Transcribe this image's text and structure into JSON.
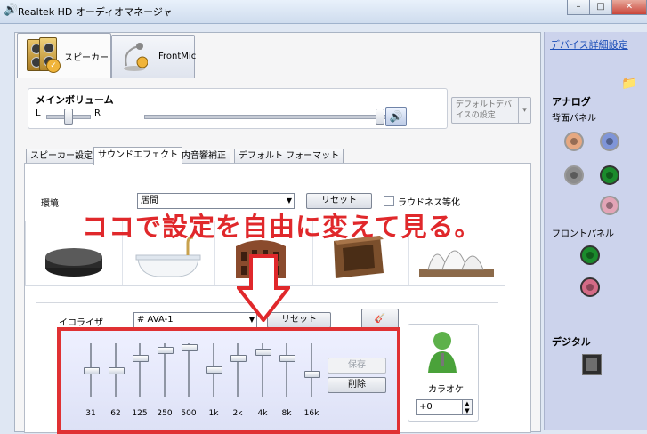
{
  "window": {
    "title": "Realtek HD オーディオマネージャ"
  },
  "device_tabs": [
    {
      "label": "スピーカー"
    },
    {
      "label": "FrontMic"
    }
  ],
  "main_volume": {
    "title": "メインボリューム",
    "left": "L",
    "right": "R"
  },
  "default_device": {
    "label": "デフォルトデバイスの設定"
  },
  "sub_tabs": [
    {
      "label": "スピーカー設定"
    },
    {
      "label": "サウンドエフェクト"
    },
    {
      "label": "室内音響補正"
    },
    {
      "label": "デフォルト フォーマット"
    }
  ],
  "environment": {
    "label": "環境",
    "selected": "居間",
    "reset_label": "リセット",
    "loudness_label": "ラウドネス等化",
    "presets": [
      "stone-disc-icon",
      "bathtub-icon",
      "colosseum-icon",
      "stone-room-icon",
      "opera-house-icon"
    ]
  },
  "annotation": {
    "text": "ココで設定を自由に変えて見る。"
  },
  "equalizer": {
    "label": "イコライザ",
    "selected": "# AVA-1",
    "reset_label": "リセット",
    "save_label": "保存",
    "delete_label": "削除",
    "bands": [
      {
        "freq": "31",
        "level": 0.48
      },
      {
        "freq": "62",
        "level": 0.48
      },
      {
        "freq": "125",
        "level": 0.75
      },
      {
        "freq": "250",
        "level": 0.92
      },
      {
        "freq": "500",
        "level": 0.98
      },
      {
        "freq": "1k",
        "level": 0.5
      },
      {
        "freq": "2k",
        "level": 0.75
      },
      {
        "freq": "4k",
        "level": 0.88
      },
      {
        "freq": "8k",
        "level": 0.75
      },
      {
        "freq": "16k",
        "level": 0.4
      }
    ]
  },
  "karaoke": {
    "label": "カラオケ",
    "value": "+0"
  },
  "sidebar": {
    "link": "デバイス詳細設定",
    "analog": "アナログ",
    "back_panel": "背面パネル",
    "front_panel": "フロントパネル",
    "digital": "デジタル"
  },
  "colors": {
    "annotation": "#e0282b",
    "link": "#1d4fb8"
  }
}
